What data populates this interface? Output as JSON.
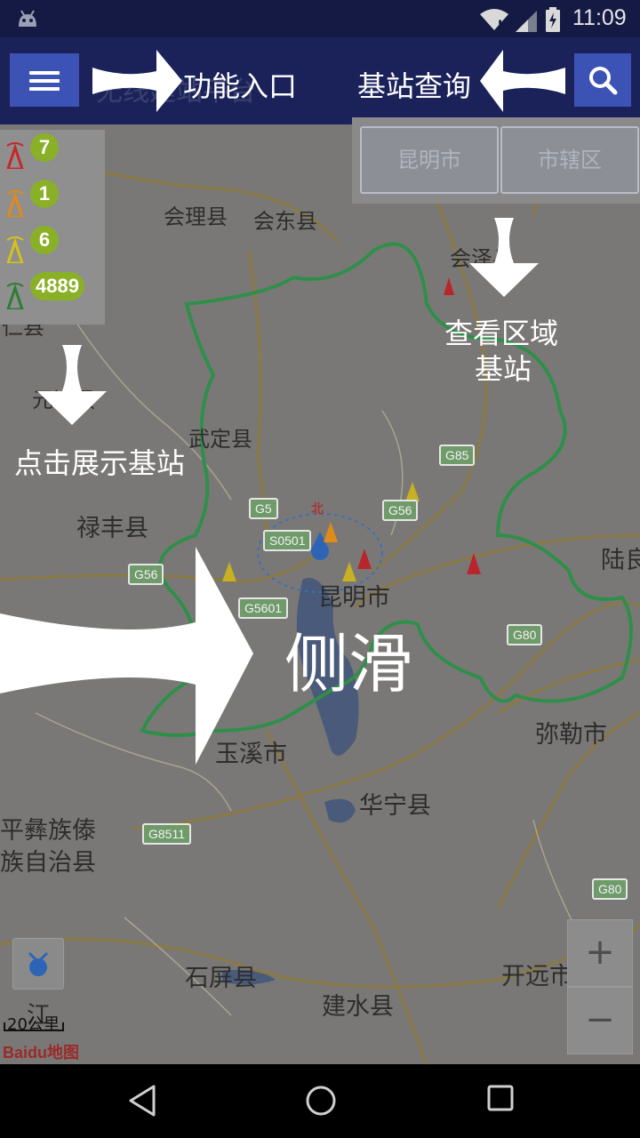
{
  "status_bar": {
    "time": "11:09"
  },
  "app_bar": {
    "ghost_title": "无线建站平台",
    "function_entry_label": "功能入口",
    "base_station_query_label": "基站查询"
  },
  "district_selector": {
    "city": "昆明市",
    "district": "市辖区"
  },
  "legend": {
    "counts": [
      {
        "count": "7",
        "color": "#e53935"
      },
      {
        "count": "1",
        "color": "#f9a825"
      },
      {
        "count": "6",
        "color": "#fdd835"
      },
      {
        "count": "4889",
        "color": "#43a047"
      }
    ]
  },
  "map": {
    "places": [
      {
        "name": "会理县"
      },
      {
        "name": "会东县"
      },
      {
        "name": "会泽县"
      },
      {
        "name": "仁县"
      },
      {
        "name": "元谋县"
      },
      {
        "name": "武定县"
      },
      {
        "name": "禄丰县"
      },
      {
        "name": "昆明市"
      },
      {
        "name": "陆良"
      },
      {
        "name": "玉溪市"
      },
      {
        "name": "弥勒市"
      },
      {
        "name": "华宁县"
      },
      {
        "name": "平彝族傣"
      },
      {
        "name": "族自治县"
      },
      {
        "name": "石屏县"
      },
      {
        "name": "建水县"
      },
      {
        "name": "开远市"
      },
      {
        "name": "江"
      }
    ],
    "roads": [
      "G5",
      "G85",
      "G5",
      "G56",
      "S0501",
      "G56",
      "G5601",
      "G80",
      "G8511",
      "G80"
    ],
    "north_label": "北",
    "scale_label": "20公里",
    "logo": "Baidu地图"
  },
  "annotations": {
    "view_area_line1": "查看区域",
    "view_area_line2": "基站",
    "click_show": "点击展示基站",
    "side_slide": "侧滑"
  },
  "zoom": {
    "in": "+",
    "out": "−"
  }
}
